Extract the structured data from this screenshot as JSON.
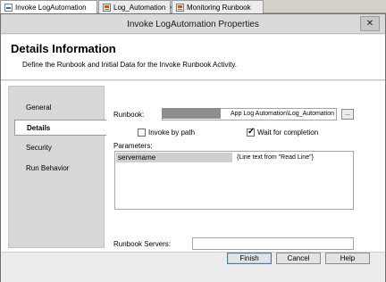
{
  "tabs": [
    {
      "label": "Invoke LogAutomation",
      "icon": "runbook-doc-icon",
      "active": true
    },
    {
      "label": "Log_Automation",
      "icon": "runbook-log-icon"
    },
    {
      "label": "Monitoring Runbook",
      "icon": "runbook-log-icon"
    }
  ],
  "tab_close": "×",
  "dialog": {
    "title": "Invoke LogAutomation Properties",
    "close_label": "✕"
  },
  "header": {
    "title": "Details Information",
    "description": "Define the Runbook and Initial Data for the Invoke Runbook Activity."
  },
  "sidebar": {
    "items": [
      "General",
      "Details",
      "Security",
      "Run Behavior"
    ],
    "active": "Details"
  },
  "form": {
    "runbook_label": "Runbook:",
    "runbook_value": "App Log Automation\\Log_Automation",
    "browse_label": "...",
    "invoke_by_path_label": "Invoke by path",
    "invoke_by_path_checked": false,
    "wait_label": "Wait for completion",
    "wait_checked": true,
    "parameters_label": "Parameters:",
    "parameters": [
      {
        "name": "servername",
        "value": "{Line text from \"Read Line\"}"
      }
    ],
    "runbook_servers_label": "Runbook Servers:",
    "runbook_servers_value": ""
  },
  "buttons": {
    "finish": "Finish",
    "cancel": "Cancel",
    "help": "Help"
  },
  "colors": {
    "title_bar": "#dadada",
    "sidebar": "#d8d8d8",
    "primary_button_border": "#3c7fb1"
  }
}
